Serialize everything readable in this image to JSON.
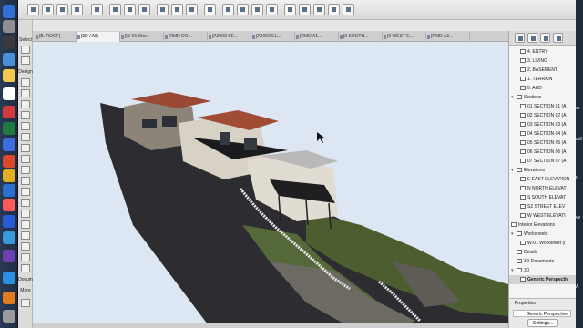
{
  "toolbox": {
    "select_label": "Select",
    "design_label": "Design",
    "document_label": "Docum",
    "more_label": "More"
  },
  "tabs": [
    {
      "label": "[B. ROOF]",
      "active": false
    },
    {
      "label": "[3D / All]",
      "active": true
    },
    {
      "label": "[W-01 Wor...",
      "active": false
    },
    {
      "label": "[RMD DO...",
      "active": false
    },
    {
      "label": "[A3003 SE...",
      "active": false
    },
    {
      "label": "[A4002 EL...",
      "active": false
    },
    {
      "label": "[RMD A1...",
      "active": false
    },
    {
      "label": "[0 SOUTH...",
      "active": false
    },
    {
      "label": "[0 WEST E...",
      "active": false
    },
    {
      "label": "[RMD A3...",
      "active": false
    }
  ],
  "navigator": {
    "stories": [
      "4. ENTRY",
      "3. LIVING",
      "2. BASEMENT",
      "1. TERRAIN",
      "0. AHD"
    ],
    "sections_label": "Sections",
    "sections": [
      "01 SECTION 01 (A",
      "02 SECTION 02 (A",
      "03 SECTION 03 (A",
      "04 SECTION 04 (A",
      "05 SECTION 05 (A",
      "06 SECTION 06 (A",
      "07 SECTION 07 (A"
    ],
    "elevations_label": "Elevations",
    "elevations": [
      "E EAST ELEVATION",
      "N NORTH ELEVAT",
      "S SOUTH ELEVAT",
      "S2 STREET ELEV",
      "W WEST ELEVATI"
    ],
    "interior_elevations_label": "Interior Elevations",
    "worksheets_label": "Worksheets",
    "worksheet_item": "W-01 Worksheet (I",
    "details_label": "Details",
    "documents_3d_label": "3D Documents",
    "view_3d_label": "3D",
    "generic_perspective_label": "Generic Perspectiv"
  },
  "properties": {
    "title": "Properties",
    "value": "Generic Perspective",
    "settings_label": "Settings..."
  },
  "edge_text": [
    "ar",
    "adf",
    "d",
    "ve",
    "A"
  ]
}
